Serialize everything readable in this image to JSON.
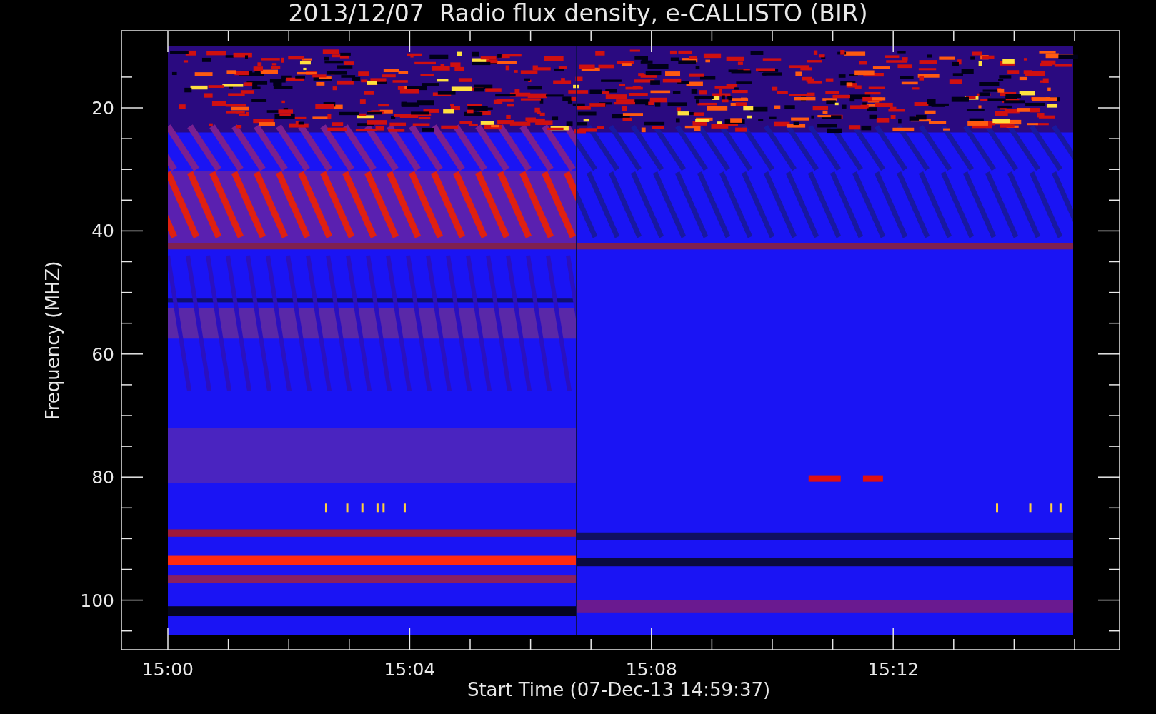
{
  "title": "2013/12/07  Radio flux density, e-CALLISTO (BIR)",
  "plot": {
    "ylabel": "Frequency (MHZ)",
    "xlabel": "Start Time (07-Dec-13 14:59:37)",
    "yticks": [
      "20",
      "40",
      "60",
      "80",
      "100"
    ],
    "xticks": [
      "15:00",
      "15:04",
      "15:08",
      "15:12"
    ]
  }
}
